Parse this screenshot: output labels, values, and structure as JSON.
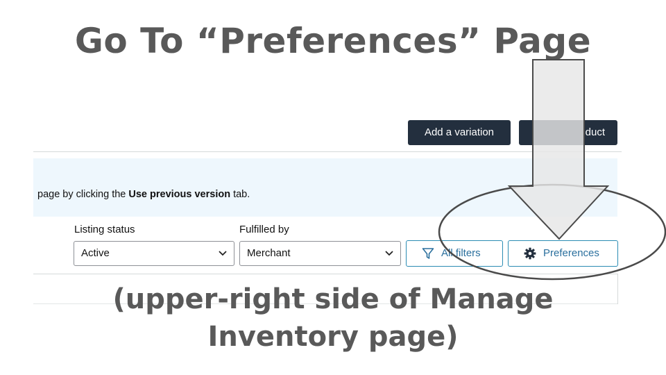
{
  "title": "Go To “Preferences” Page",
  "caption": {
    "line1": "(upper-right side of Manage",
    "line2": "Inventory page)"
  },
  "toolbar": {
    "add_variation": "Add a variation",
    "add_product_partial": "duct"
  },
  "banner": {
    "prefix": "page by clicking the ",
    "bold": "Use previous version",
    "suffix": " tab."
  },
  "filters": {
    "listing_status_label": "Listing status",
    "listing_status_value": "Active",
    "fulfilled_by_label": "Fulfilled by",
    "fulfilled_by_value": "Merchant",
    "all_filters": "All filters",
    "preferences": "Preferences"
  },
  "colors": {
    "heading": "#595959",
    "dark_button": "#232f3e",
    "banner_bg": "#eef7fd",
    "link_blue": "#2a6f9d",
    "arrow_fill": "#e6e6e6",
    "arrow_stroke": "#4a4a4a"
  },
  "icons": [
    "filter-icon",
    "gear-icon",
    "chevron-down-icon",
    "down-arrow-annotation"
  ]
}
